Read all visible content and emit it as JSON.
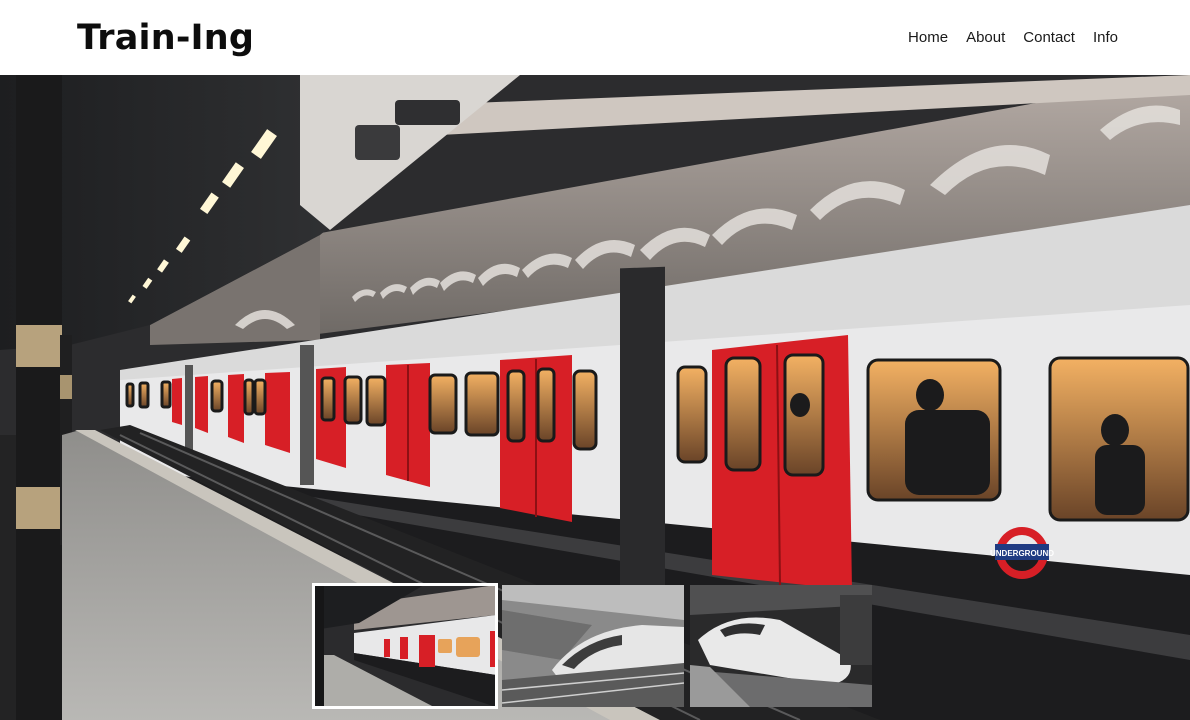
{
  "brand": {
    "logo_text": "Train-Ing"
  },
  "nav": {
    "items": [
      {
        "label": "Home"
      },
      {
        "label": "About"
      },
      {
        "label": "Contact"
      },
      {
        "label": "Info"
      }
    ]
  },
  "hero": {
    "image": "subway-train-at-platform",
    "roundel_text": "UNDERGROUND",
    "colors": {
      "train_body": "#e9e9ea",
      "door_red": "#d71f26",
      "brick": "#8d8985",
      "platform": "#a7a6a3"
    }
  },
  "gallery": {
    "thumbnails": [
      {
        "image": "subway-train-at-platform",
        "active": true
      },
      {
        "image": "high-speed-train-grayscale",
        "active": false
      },
      {
        "image": "high-speed-train-station-grayscale",
        "active": false
      }
    ]
  }
}
